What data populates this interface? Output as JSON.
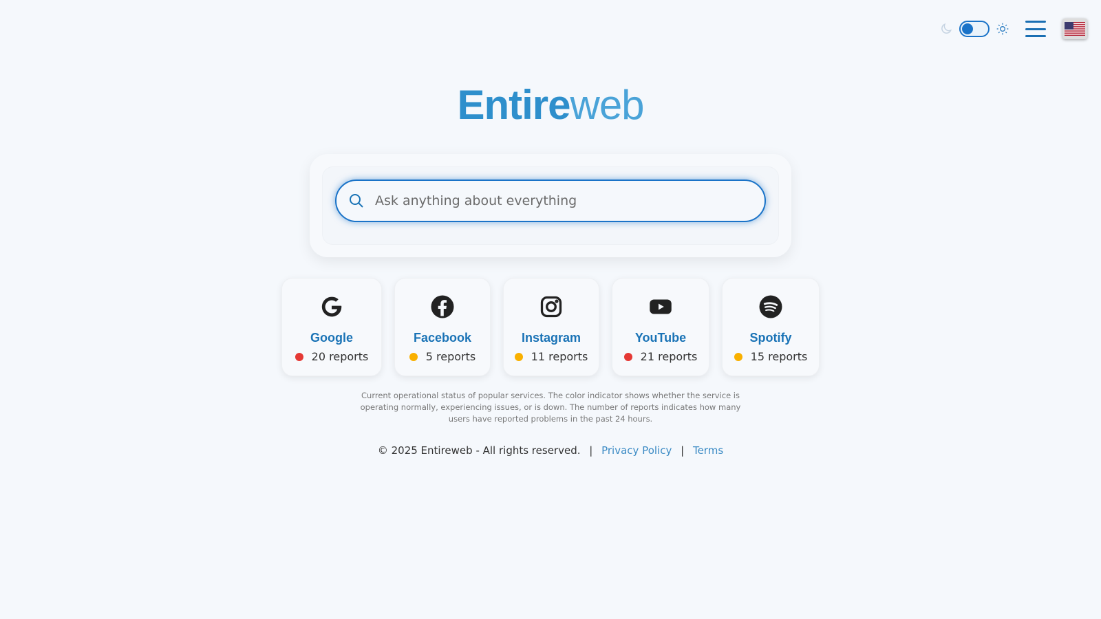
{
  "header": {
    "theme_toggle": {
      "dark_icon": "moon-icon",
      "light_icon": "sun-icon",
      "accent": "#1a73c8"
    },
    "menu_icon": "hamburger-menu-icon",
    "language_flag": "us-flag-icon"
  },
  "logo": {
    "part1": "Entire",
    "part2": "web",
    "color_bold": "#2e8fcc",
    "color_light": "#4aa3d8"
  },
  "search": {
    "placeholder": "Ask anything about everything",
    "value": "",
    "icon": "search-icon"
  },
  "services": [
    {
      "name": "Google",
      "icon": "google-icon",
      "reports": "20 reports",
      "status_color": "#e53935"
    },
    {
      "name": "Facebook",
      "icon": "facebook-icon",
      "reports": "5 reports",
      "status_color": "#f9b000"
    },
    {
      "name": "Instagram",
      "icon": "instagram-icon",
      "reports": "11 reports",
      "status_color": "#f9b000"
    },
    {
      "name": "YouTube",
      "icon": "youtube-icon",
      "reports": "21 reports",
      "status_color": "#e53935"
    },
    {
      "name": "Spotify",
      "icon": "spotify-icon",
      "reports": "15 reports",
      "status_color": "#f9b000"
    }
  ],
  "status_note": "Current operational status of popular services. The color indicator shows whether the service is operating normally, experiencing issues, or is down. The number of reports indicates how many users have reported problems in the past 24 hours.",
  "footer": {
    "copyright": "© 2025 Entireweb - All rights reserved.",
    "separator": "|",
    "privacy": "Privacy Policy",
    "terms": "Terms"
  }
}
